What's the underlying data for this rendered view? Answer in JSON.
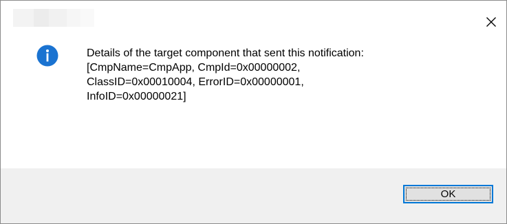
{
  "dialog": {
    "title": "",
    "message": "Details of the target component that sent this notification:\n[CmpName=CmpApp, CmpId=0x00000002,\nClassID=0x00010004, ErrorID=0x00000001,\nInfoID=0x00000021]",
    "icon": "info-icon",
    "ok_label": "OK",
    "close_icon": "close-icon"
  },
  "colors": {
    "accent": "#0078d7",
    "footer_bg": "#f0f0f0",
    "button_bg": "#e1e1e1"
  }
}
